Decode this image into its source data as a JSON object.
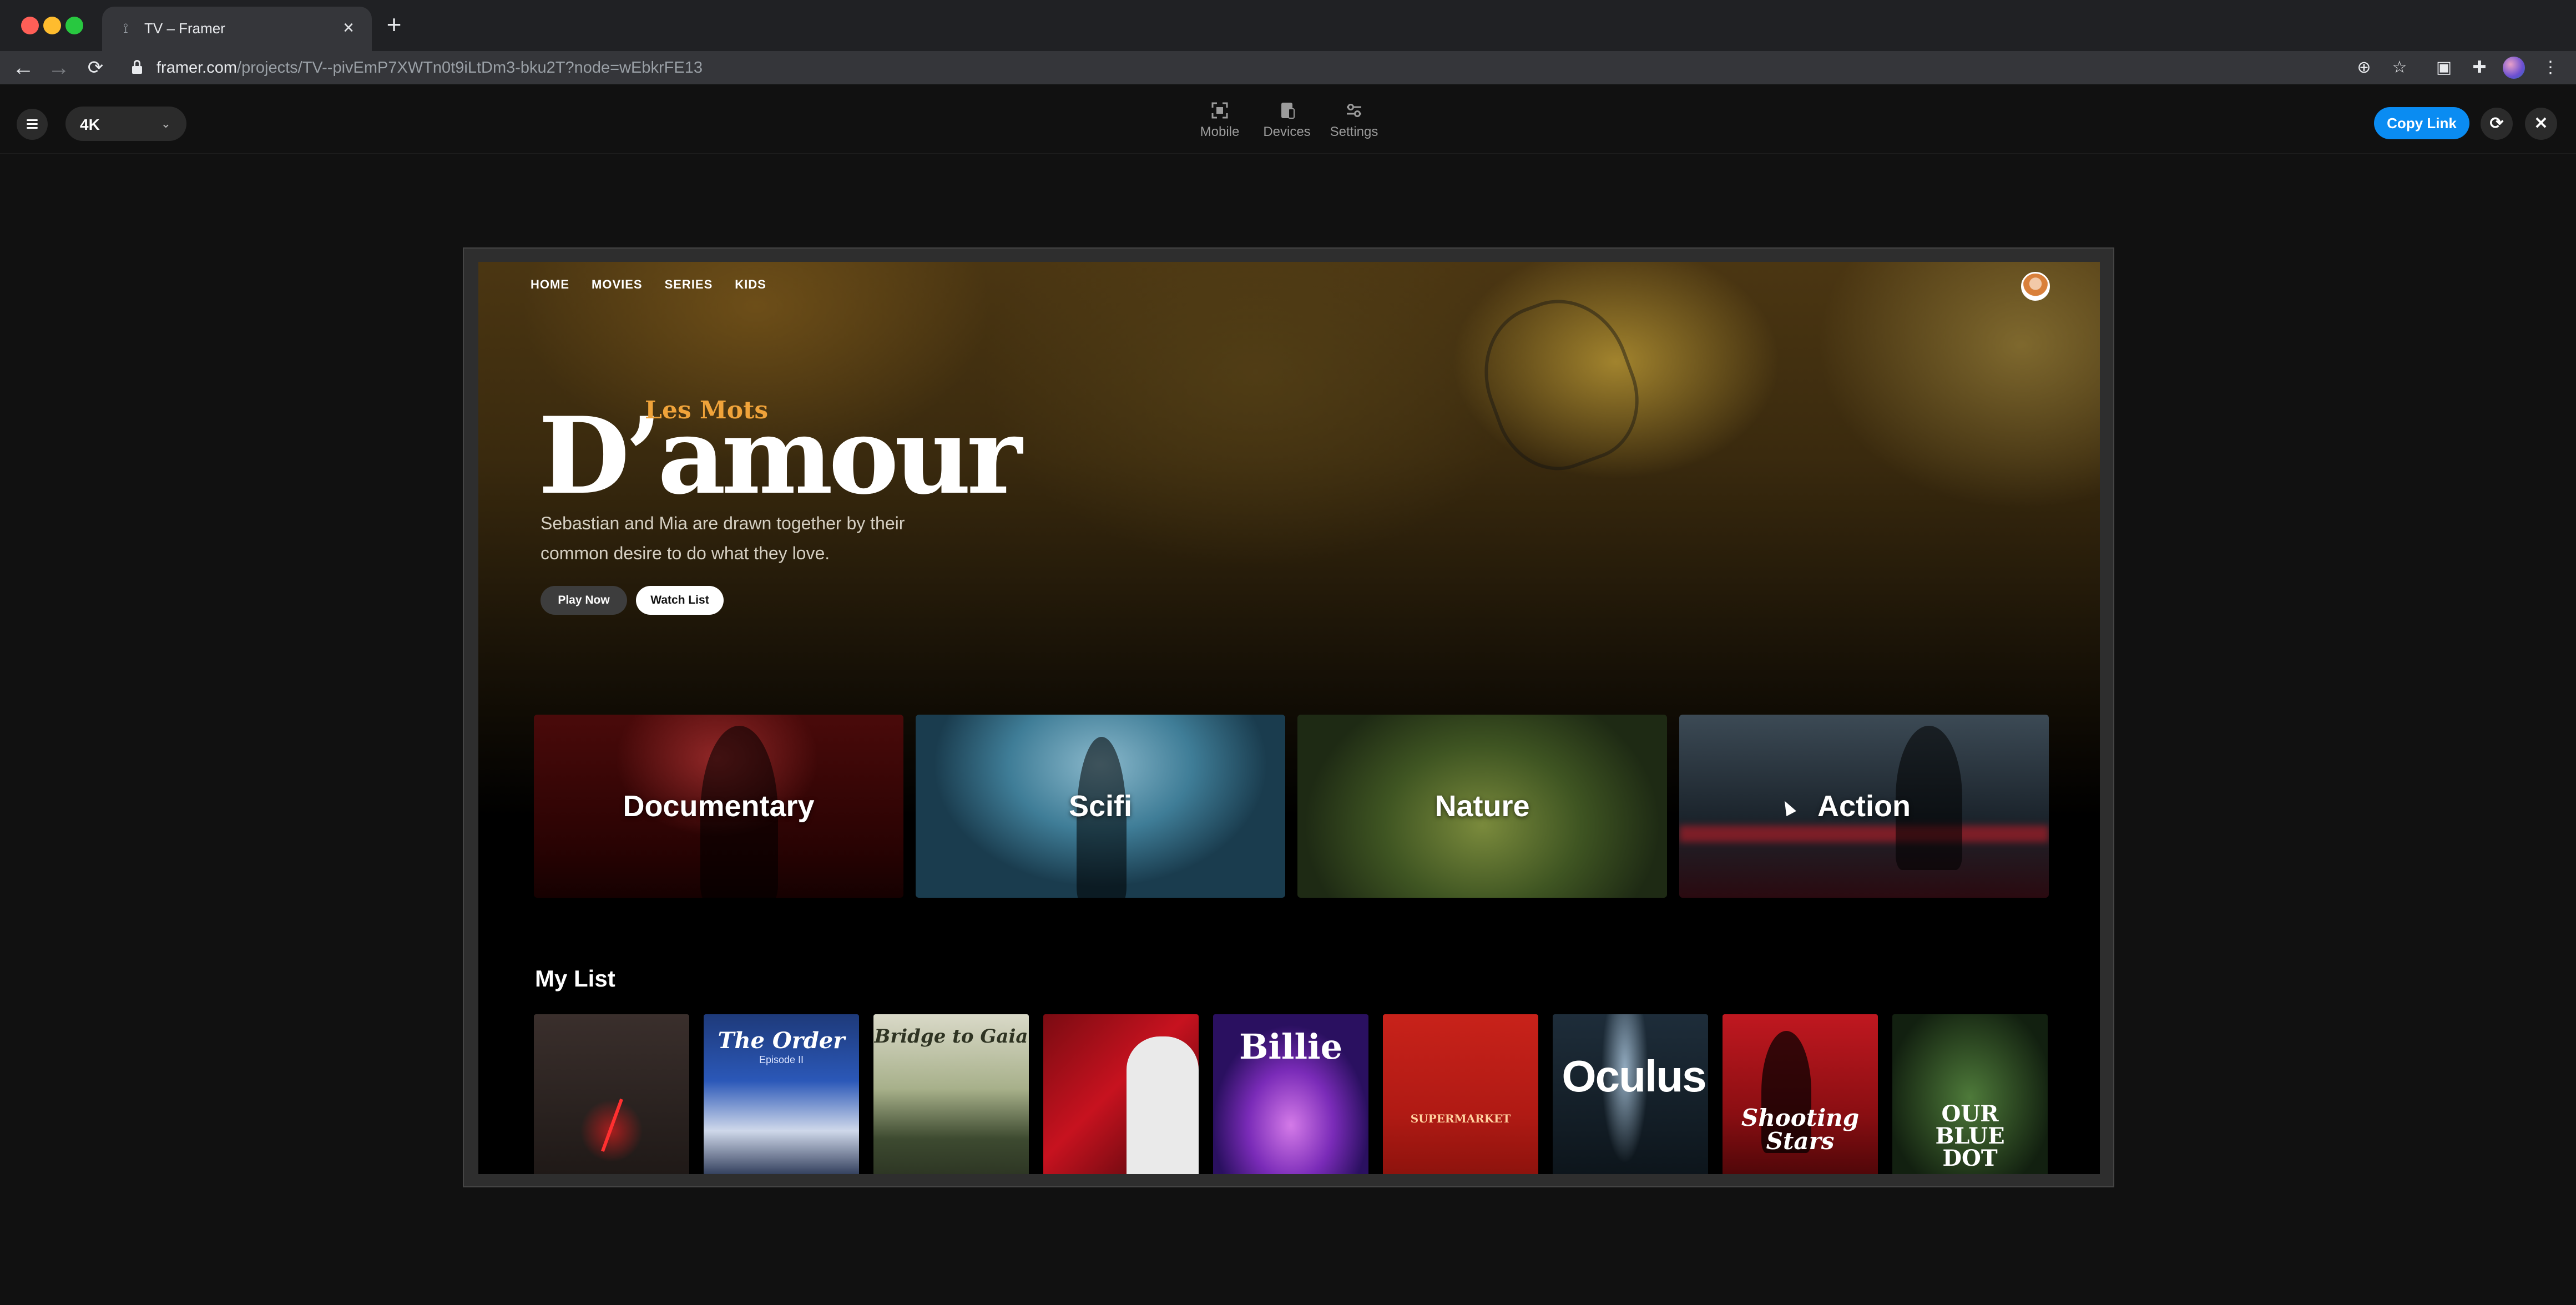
{
  "browser": {
    "tab_title": "TV – Framer",
    "tab_close": "×",
    "new_tab": "+",
    "url_host": "framer.com",
    "url_path": "/projects/TV--pivEmP7XWTn0t9iLtDm3-bku2T?node=wEbkrFE13",
    "traffic_colors": [
      "#ff5f57",
      "#febc2e",
      "#28c840"
    ]
  },
  "framer": {
    "resolution": "4K",
    "toolbar_items": [
      {
        "label": "Mobile",
        "icon": "fullscreen-icon"
      },
      {
        "label": "Devices",
        "icon": "devices-icon"
      },
      {
        "label": "Settings",
        "icon": "sliders-icon"
      }
    ],
    "copy_link": "Copy Link",
    "accent": "#0a8cf2"
  },
  "app": {
    "nav": [
      "HOME",
      "MOVIES",
      "SERIES",
      "KIDS"
    ],
    "hero": {
      "title_small": "Les Mots",
      "title_big": "D’amour",
      "description": "Sebastian and Mia are drawn together by their common desire to do what they love.",
      "play_button": "Play Now",
      "watch_button": "Watch List"
    },
    "categories": [
      {
        "label": "Documentary"
      },
      {
        "label": "Scifi"
      },
      {
        "label": "Nature"
      },
      {
        "label": "Action"
      }
    ],
    "my_list_title": "My List",
    "my_list": [
      {
        "title": ""
      },
      {
        "title": "The Order",
        "subtitle": "Episode II"
      },
      {
        "title": "Bridge to Gaia"
      },
      {
        "title": ""
      },
      {
        "title": "Billie"
      },
      {
        "title": "SUPERMARKET"
      },
      {
        "title": "Oculus"
      },
      {
        "title": "Shooting Stars"
      },
      {
        "title": "OUR BLUE DOT"
      }
    ]
  }
}
